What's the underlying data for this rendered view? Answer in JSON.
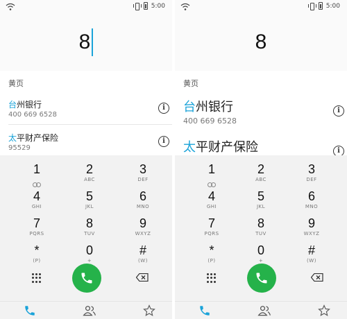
{
  "status": {
    "time": "5:00"
  },
  "left": {
    "dialed": "8",
    "section": "黄页",
    "results": [
      {
        "highlight": "台",
        "rest": "州银行",
        "number": "400 669 6528"
      },
      {
        "highlight": "太",
        "rest": "平财产保险",
        "number": "95529"
      }
    ]
  },
  "right": {
    "dialed": "8",
    "section": "黄页",
    "results": [
      {
        "highlight": "台",
        "rest": "州银行",
        "number": "400 669 6528"
      },
      {
        "highlight": "太",
        "rest": "平财产保险"
      }
    ]
  },
  "keys": [
    {
      "digit": "1",
      "letters": ""
    },
    {
      "digit": "2",
      "letters": "ABC"
    },
    {
      "digit": "3",
      "letters": "DEF"
    },
    {
      "digit": "4",
      "letters": "GHI"
    },
    {
      "digit": "5",
      "letters": "JKL"
    },
    {
      "digit": "6",
      "letters": "MNO"
    },
    {
      "digit": "7",
      "letters": "PQRS"
    },
    {
      "digit": "8",
      "letters": "TUV"
    },
    {
      "digit": "9",
      "letters": "WXYZ"
    },
    {
      "digit": "*",
      "letters": "(P)"
    },
    {
      "digit": "0",
      "letters": "+"
    },
    {
      "digit": "#",
      "letters": "(W)"
    }
  ],
  "info_glyph": "i",
  "colors": {
    "accent": "#1aa3d9",
    "call": "#25b24a",
    "highlight": "#1aa3d9"
  },
  "icons": [
    "wifi-icon",
    "vibrate-icon",
    "battery-icon",
    "info-icon",
    "voicemail-icon",
    "dialpad-icon",
    "call-icon",
    "backspace-icon",
    "phone-icon",
    "contacts-icon",
    "favorites-star-icon"
  ]
}
